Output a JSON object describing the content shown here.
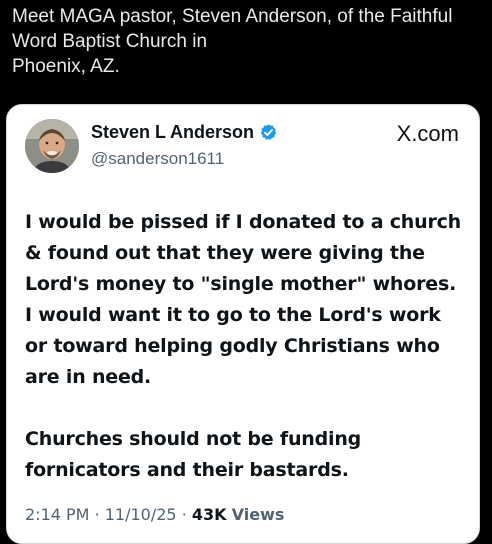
{
  "caption": {
    "lines": [
      "Meet MAGA pastor, Steven Anderson, of the Faithful",
      "Word Baptist Church in",
      "Phoenix, AZ."
    ]
  },
  "tweet": {
    "author_name": "Steven L Anderson",
    "handle": "@sanderson1611",
    "brand": "X.com",
    "paragraphs": [
      "I would be pissed if I donated to a church & found out that they were giving the Lord's money to \"single mother\" whores. I would want it to go to the Lord's work or toward helping godly Christians who are in need.",
      "Churches should not be funding fornicators and their bastards."
    ],
    "time": "2:14 PM",
    "date": "11/10/25",
    "views_count": "43K",
    "views_label": "Views",
    "separator": "·"
  },
  "colors": {
    "background": "#000000",
    "card": "#ffffff",
    "verified": "#1d9bf0",
    "secondary_text": "#536471"
  },
  "icons": [
    "verified-badge-icon",
    "x-logo-icon"
  ]
}
